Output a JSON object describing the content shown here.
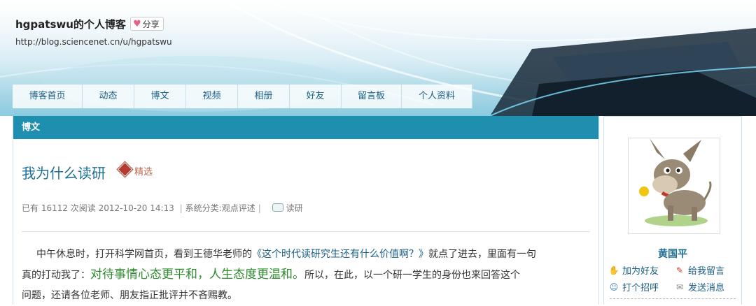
{
  "header": {
    "blog_title": "hgpatswu的个人博客",
    "share_label": "分享",
    "blog_url": "http://blog.sciencenet.cn/u/hgpatswu"
  },
  "nav": [
    "博客首页",
    "动态",
    "博文",
    "视频",
    "相册",
    "好友",
    "留言板",
    "个人资料"
  ],
  "panel": {
    "heading": "博文"
  },
  "post": {
    "title": "我为什么读研",
    "featured_label": "精选",
    "meta": {
      "reads": "已有 16112 次阅读",
      "datetime": "2012-10-20 14:13",
      "category": "系统分类:观点评述",
      "tag": "读研"
    },
    "body": {
      "line1_a": "中午休息时，打开科学网首页，看到王德华老师的",
      "line1_link": "《这个时代读研究生还有什么价值啊？》",
      "line1_b": "就点了进去，里面有一句",
      "line2_a": "真的打动我了：",
      "line2_hl": "对待事情心态更平和，人生态度更温和。",
      "line2_b": "所以，在此，以一个研一学生的身份也来回答这个",
      "line3": "问题，还请各位老师、朋友指正批评并不吝赐教。"
    }
  },
  "sidebar": {
    "owner_name": "黄国平",
    "actions": {
      "add_friend": "加为好友",
      "leave_message": "给我留言",
      "greet": "打个招呼",
      "send_message": "发送消息"
    }
  }
}
